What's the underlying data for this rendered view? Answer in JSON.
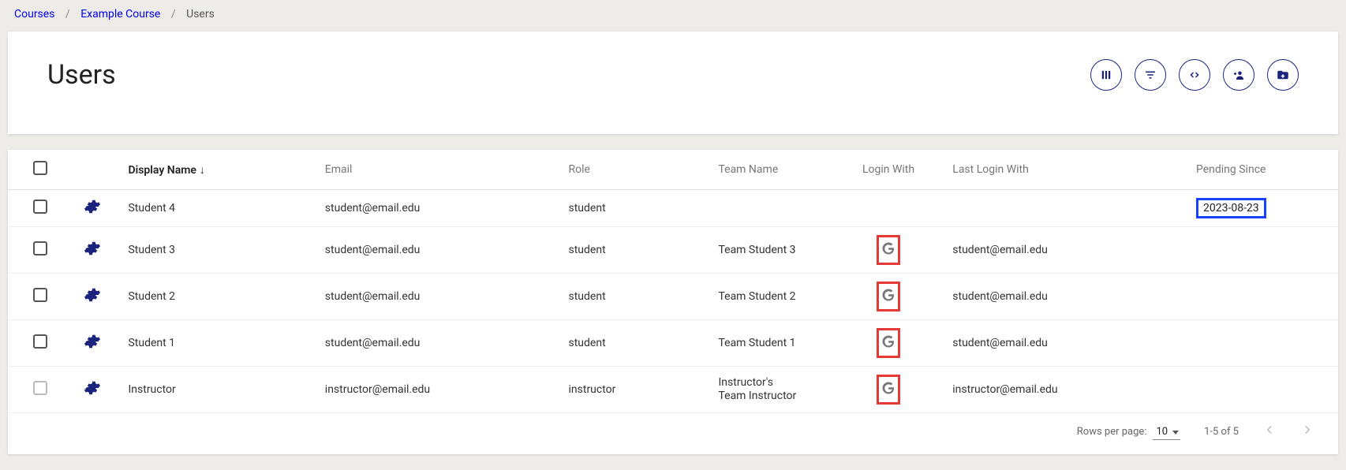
{
  "breadcrumb": {
    "items": [
      "Courses",
      "Example Course",
      "Users"
    ]
  },
  "page": {
    "title": "Users"
  },
  "actions": {
    "columns": "columns",
    "filter": "filter",
    "embed": "embed",
    "add_user": "add user",
    "import": "import"
  },
  "table": {
    "headers": {
      "display_name": "Display Name",
      "email": "Email",
      "role": "Role",
      "team_name": "Team Name",
      "login_with": "Login With",
      "last_login_with": "Last Login With",
      "pending_since": "Pending Since"
    },
    "rows": [
      {
        "display_name": "Student 4",
        "email": "student@email.edu",
        "role": "student",
        "team_name": "",
        "login_with": "",
        "last_login_with": "",
        "pending_since": "2023-08-23",
        "checkbox_disabled": false
      },
      {
        "display_name": "Student 3",
        "email": "student@email.edu",
        "role": "student",
        "team_name": "Team Student 3",
        "login_with": "google",
        "last_login_with": "student@email.edu",
        "pending_since": "",
        "checkbox_disabled": false
      },
      {
        "display_name": "Student 2",
        "email": "student@email.edu",
        "role": "student",
        "team_name": "Team Student 2",
        "login_with": "google",
        "last_login_with": "student@email.edu",
        "pending_since": "",
        "checkbox_disabled": false
      },
      {
        "display_name": "Student 1",
        "email": "student@email.edu",
        "role": "student",
        "team_name": "Team Student 1",
        "login_with": "google",
        "last_login_with": "student@email.edu",
        "pending_since": "",
        "checkbox_disabled": false
      },
      {
        "display_name": "Instructor",
        "email": "instructor@email.edu",
        "role": "instructor",
        "team_name": "Instructor's Team Instructor",
        "login_with": "google",
        "last_login_with": "instructor@email.edu",
        "pending_since": "",
        "checkbox_disabled": true
      }
    ]
  },
  "footer": {
    "rows_per_page_label": "Rows per page:",
    "rows_per_page_value": "10",
    "range": "1-5 of 5"
  }
}
